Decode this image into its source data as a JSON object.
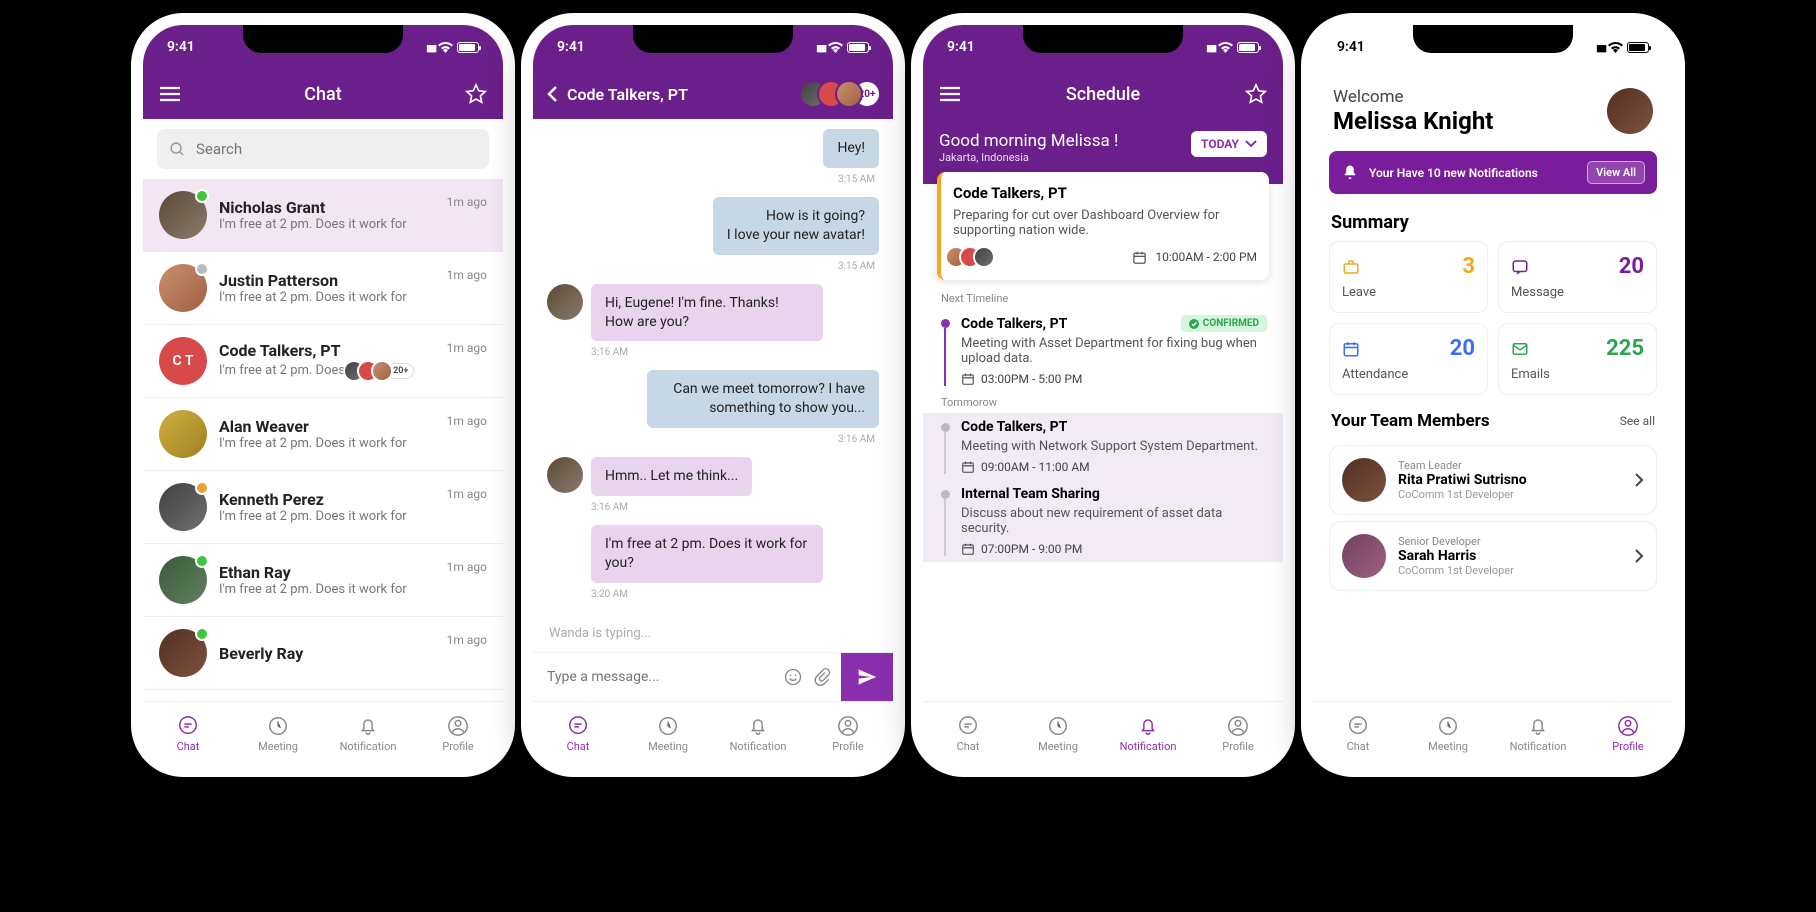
{
  "status_time": "9:41",
  "screen1": {
    "title": "Chat",
    "search_placeholder": "Search",
    "items": [
      {
        "name": "Nicholas Grant",
        "preview": "I'm free at 2 pm. Does it work for",
        "time": "1m ago",
        "dot": "green",
        "active": true,
        "avClass": "av1"
      },
      {
        "name": "Justin Patterson",
        "preview": "I'm free at 2 pm. Does it work for",
        "time": "1m ago",
        "dot": "gray",
        "avClass": "av2"
      },
      {
        "name": "Code Talkers, PT",
        "preview": "I'm free at 2 pm. Does",
        "time": "1m ago",
        "dot": "",
        "initials": "C T",
        "avClass": "av3",
        "group": true,
        "group_more": "20+"
      },
      {
        "name": "Alan Weaver",
        "preview": "I'm free at 2 pm. Does it work for",
        "time": "1m ago",
        "dot": "",
        "avClass": "av4"
      },
      {
        "name": "Kenneth Perez",
        "preview": "I'm free at 2 pm. Does it work for",
        "time": "1m ago",
        "dot": "orange",
        "avClass": "av5"
      },
      {
        "name": "Ethan Ray",
        "preview": "I'm free at 2 pm. Does it work for",
        "time": "1m ago",
        "dot": "green",
        "avClass": "av6"
      },
      {
        "name": "Beverly Ray",
        "preview": "",
        "time": "1m ago",
        "dot": "green",
        "avClass": "av7"
      }
    ]
  },
  "screen2": {
    "title": "Code Talkers, PT",
    "member_more": "20+",
    "messages": [
      {
        "side": "right",
        "text": "Hey!",
        "time": "3:15 AM"
      },
      {
        "side": "right",
        "text": "How is it going?\nI love your new avatar!",
        "time": "3:15 AM"
      },
      {
        "side": "left",
        "text": "Hi, Eugene! I'm fine. Thanks! How are you?",
        "time": "3:16 AM",
        "avatar": true
      },
      {
        "side": "right",
        "text": "Can we meet tomorrow? I have something to show you...",
        "time": "3:16 AM"
      },
      {
        "side": "left",
        "text": "Hmm.. Let me think...",
        "time": "3:16 AM",
        "avatar": true
      },
      {
        "side": "left",
        "text": "I'm free at 2 pm. Does it work for you?",
        "time": "3:20 AM"
      }
    ],
    "typing": "Wanda is typing...",
    "input_placeholder": "Type a message..."
  },
  "screen3": {
    "title": "Schedule",
    "greeting": "Good morning  Melissa !",
    "location": "Jakarta, Indonesia",
    "today_btn": "TODAY",
    "card": {
      "title": "Code Talkers, PT",
      "desc": "Preparing for cut over Dashboard Overview for supporting nation wide.",
      "time": "10:00AM - 2:00 PM"
    },
    "next_label": "Next Timeline",
    "tomorrow_label": "Tommorow",
    "confirmed": "CONFIRMED",
    "timeline": [
      {
        "title": "Code Talkers, PT",
        "desc": "Meeting with Asset Department for fixing bug when upload data.",
        "time": "03:00PM - 5:00 PM",
        "confirmed": true
      },
      {
        "title": "Code Talkers, PT",
        "desc": "Meeting with Network Support System Department.",
        "time": "09:00AM - 11:00 AM",
        "shaded": true
      },
      {
        "title": "Internal Team Sharing",
        "desc": "Discuss about new requirement of asset data security.",
        "time": "07:00PM - 9:00 PM",
        "shaded": true
      }
    ]
  },
  "screen4": {
    "welcome": "Welcome",
    "username": "Melissa Knight",
    "notif_text": "Your Have 10 new Notifications",
    "view_all": "View All",
    "summary": "Summary",
    "stats": [
      {
        "label": "Leave",
        "value": "3",
        "color": "#f5a623",
        "icon": "briefcase"
      },
      {
        "label": "Message",
        "value": "20",
        "color": "#7a1d9a",
        "icon": "message"
      },
      {
        "label": "Attendance",
        "value": "20",
        "color": "#3b6ef5",
        "icon": "calendar"
      },
      {
        "label": "Emails",
        "value": "225",
        "color": "#2da44e",
        "icon": "mail"
      }
    ],
    "team_h": "Your Team Members",
    "see_all": "See all",
    "members": [
      {
        "role": "Team Leader",
        "name": "Rita Pratiwi Sutrisno",
        "sub": "CoComm 1st Developer"
      },
      {
        "role": "Senior Developer",
        "name": "Sarah Harris",
        "sub": "CoComm 1st Developer"
      }
    ]
  },
  "tabs": {
    "chat": "Chat",
    "meeting": "Meeting",
    "notification": "Notification",
    "profile": "Profile"
  }
}
